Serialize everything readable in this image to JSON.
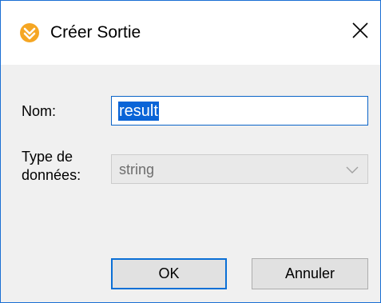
{
  "window": {
    "title": "Créer Sortie",
    "close_symbol": "×",
    "app_icon": "altova-mapforce-icon",
    "accent_color": "#f5a623",
    "border_color": "#1a6fd4"
  },
  "form": {
    "name_label": "Nom:",
    "name_value": "result",
    "type_label_line1": "Type de",
    "type_label_line2": "données:",
    "type_value": "string"
  },
  "buttons": {
    "ok_label": "OK",
    "cancel_label": "Annuler"
  }
}
